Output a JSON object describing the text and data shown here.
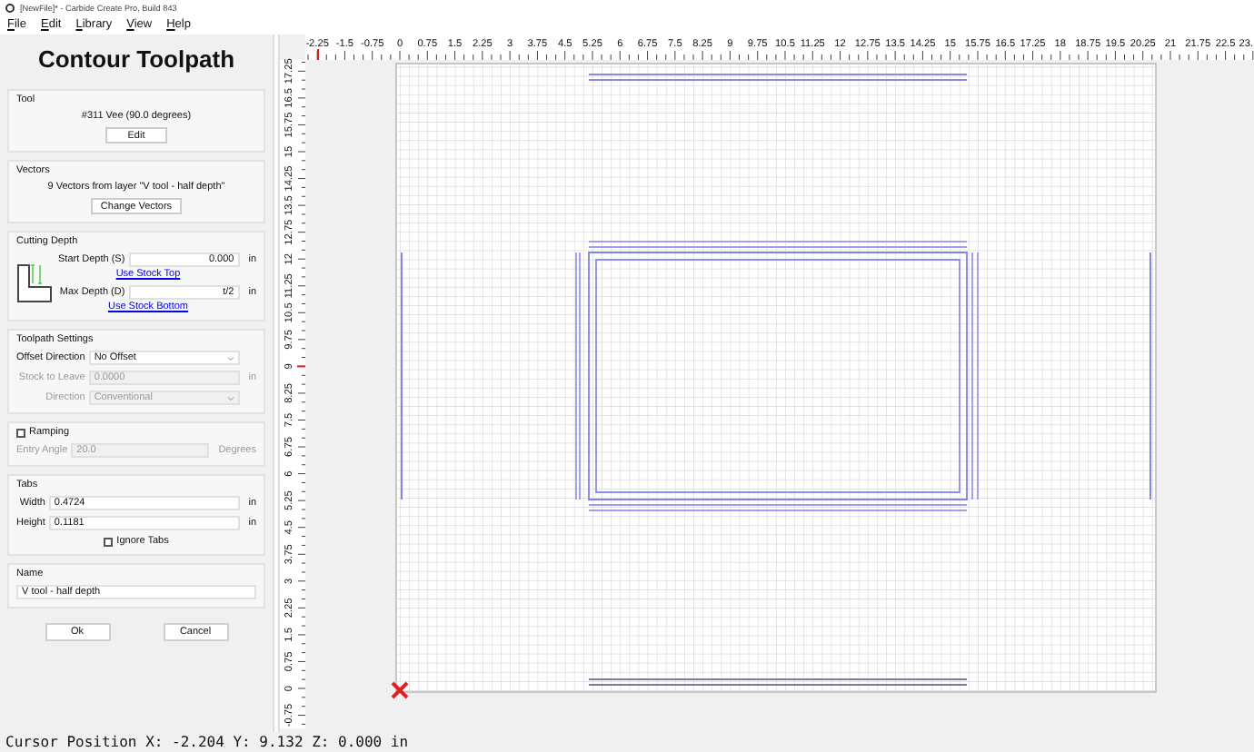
{
  "window": {
    "title": "[NewFile]* - Carbide Create Pro, Build 843"
  },
  "menu": [
    "File",
    "Edit",
    "Library",
    "View",
    "Help"
  ],
  "panel": {
    "title": "Contour Toolpath",
    "groups": [
      {
        "title": "Tool",
        "diagram": false,
        "rows": [
          {
            "kind": "text",
            "text": "#311 Vee (90.0 degrees)"
          },
          {
            "kind": "button",
            "label": "Edit"
          }
        ]
      },
      {
        "title": "Vectors",
        "diagram": false,
        "rows": [
          {
            "kind": "text",
            "text": "9 Vectors from layer \"V tool - half depth\""
          },
          {
            "kind": "button",
            "label": "Change Vectors"
          }
        ]
      },
      {
        "title": "Cutting Depth",
        "diagram": true,
        "rows": [
          {
            "kind": "field",
            "label": "Start Depth (S)",
            "value": "0.000",
            "unit": "in",
            "disabled": false
          },
          {
            "kind": "link",
            "label": "Use Stock Top"
          },
          {
            "kind": "field",
            "label": "Max Depth (D)",
            "value": "t/2",
            "unit": "in",
            "disabled": false
          },
          {
            "kind": "link",
            "label": "Use Stock Bottom"
          }
        ]
      },
      {
        "title": "Toolpath Settings",
        "diagram": false,
        "rows": [
          {
            "kind": "dropdown",
            "label": "Offset Direction",
            "value": "No Offset",
            "disabled": false
          },
          {
            "kind": "field",
            "label": "Stock to Leave",
            "value": "0.0000",
            "unit": "in",
            "disabled": true
          },
          {
            "kind": "dropdown",
            "label": "Direction",
            "value": "Conventional",
            "disabled": true
          }
        ]
      },
      {
        "diagram": false,
        "rows": [
          {
            "kind": "checkbox",
            "label": "Ramping",
            "checked": false
          },
          {
            "kind": "field",
            "label": "Entry Angle",
            "value": "20.0",
            "unit": "Degrees",
            "disabled": true
          }
        ]
      },
      {
        "title": "Tabs",
        "diagram": false,
        "rows": [
          {
            "kind": "field",
            "label": "Width",
            "value": "0.4724",
            "unit": "in",
            "disabled": false
          },
          {
            "kind": "field",
            "label": "Height",
            "value": "0.1181",
            "unit": "in",
            "disabled": false
          },
          {
            "kind": "checkbox",
            "label": "Ignore Tabs",
            "checked": false
          }
        ]
      },
      {
        "title": "Name",
        "diagram": false,
        "rows": [
          {
            "kind": "field",
            "value": "V tool - half depth",
            "disabled": false
          }
        ]
      }
    ],
    "buttons": [
      "Ok",
      "Cancel"
    ]
  },
  "top_ruler": [
    "-2.25",
    "-1.5",
    "-0.75",
    "0",
    "0.75",
    "1.5",
    "2.25",
    "3",
    "3.75",
    "4.5",
    "5.25",
    "6",
    "6.75",
    "7.5",
    "8.25",
    "9",
    "9.75",
    "10.5",
    "11.25",
    "12",
    "12.75",
    "13.5",
    "14.25",
    "15",
    "15.75",
    "16.5",
    "17.25",
    "18",
    "18.75",
    "19.5",
    "20.25",
    "21",
    "21.75",
    "22.5",
    "23."
  ],
  "left_ruler": [
    "17.25",
    "16.5",
    "15.75",
    "15",
    "14.25",
    "13.5",
    "12.75",
    "12",
    "11.25",
    "10.5",
    "9.75",
    "9",
    "8.25",
    "7.5",
    "6.75",
    "6",
    "5.25",
    "4.5",
    "3.75",
    "3",
    "2.25",
    "1.5",
    "0.75",
    "0",
    "-0.75"
  ],
  "status_bar": "Cursor Position X: -2.204 Y: 9.132 Z: 0.000 in"
}
